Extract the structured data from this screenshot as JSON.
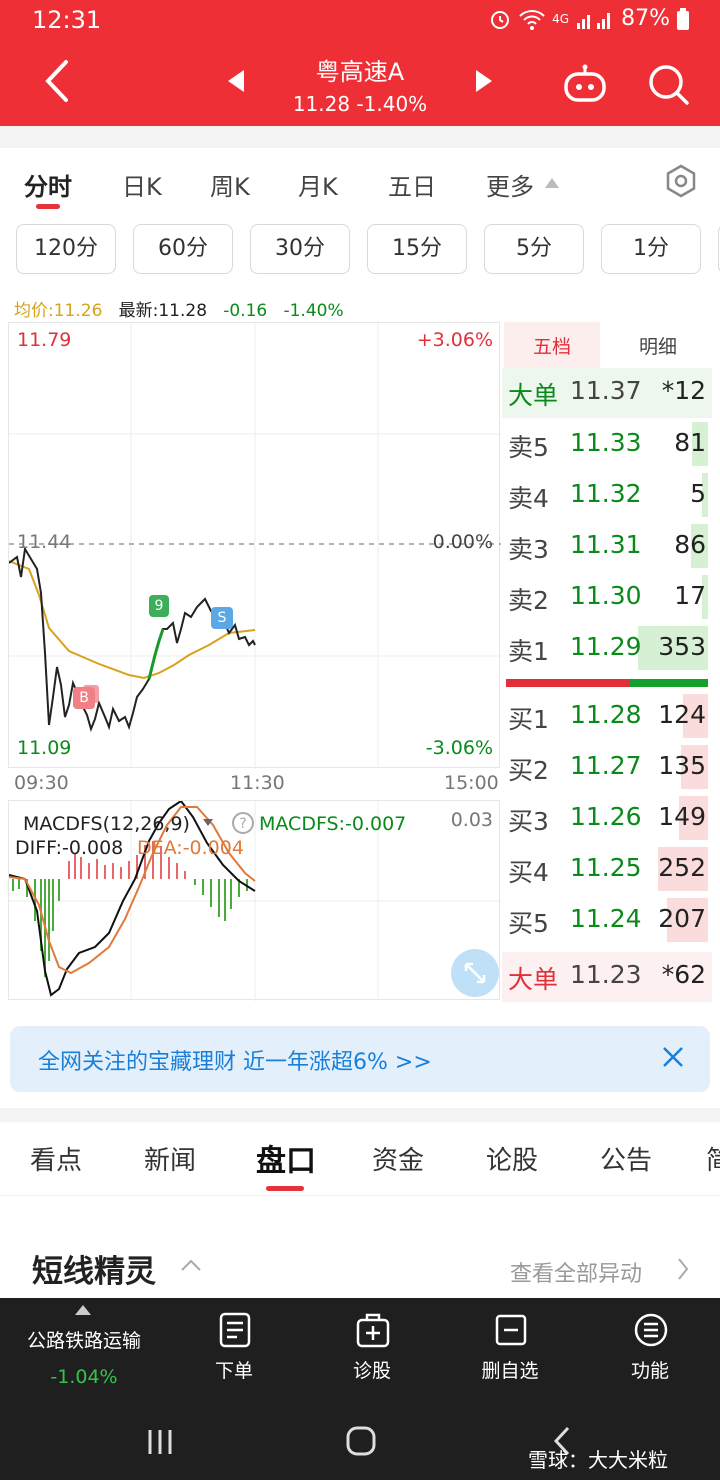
{
  "status_bar": {
    "time": "12:31",
    "network": "4G",
    "battery": "87%",
    "icons": [
      "alarm-icon",
      "wifi-icon",
      "signal-icon",
      "battery-icon"
    ]
  },
  "header": {
    "title": "粤高速A",
    "price_change": "11.28 -1.40%"
  },
  "chart_tabs": {
    "items": [
      "分时",
      "日K",
      "周K",
      "月K",
      "五日",
      "更多"
    ],
    "active": "分时"
  },
  "periods": [
    "120分",
    "60分",
    "30分",
    "15分",
    "5分",
    "1分"
  ],
  "info_line": {
    "avg": "均价:11.26",
    "latest": "最新:11.28",
    "change": "-0.16",
    "pct": "-1.40%"
  },
  "chart": {
    "price_top": "11.79",
    "price_mid": "11.44",
    "price_bottom": "11.09",
    "pct_top": "+3.06%",
    "pct_mid": "0.00%",
    "pct_bottom": "-3.06%",
    "time_start": "09:30",
    "time_mid": "11:30",
    "time_end": "15:00",
    "marker_b": "B",
    "marker_s": "S",
    "marker_9_green": "9",
    "marker_9_red": "9"
  },
  "macd": {
    "name": "MACDFS(12,26,9)",
    "value": "MACDFS:-0.007",
    "diff": "DIFF:-0.008",
    "dea": "DEA:-0.004",
    "scale_top": "0.03"
  },
  "order_book": {
    "tabs": [
      "五档",
      "明细"
    ],
    "big_sell": {
      "label": "大单",
      "price": "11.37",
      "vol": "*12"
    },
    "asks": [
      {
        "label": "卖5",
        "price": "11.33",
        "vol": "81",
        "fill": 0.23
      },
      {
        "label": "卖4",
        "price": "11.32",
        "vol": "5",
        "fill": 0.05
      },
      {
        "label": "卖3",
        "price": "11.31",
        "vol": "86",
        "fill": 0.24
      },
      {
        "label": "卖2",
        "price": "11.30",
        "vol": "17",
        "fill": 0.07
      },
      {
        "label": "卖1",
        "price": "11.29",
        "vol": "353",
        "fill": 1.0
      }
    ],
    "bids": [
      {
        "label": "买1",
        "price": "11.28",
        "vol": "124",
        "fill": 0.35
      },
      {
        "label": "买2",
        "price": "11.27",
        "vol": "135",
        "fill": 0.38
      },
      {
        "label": "买3",
        "price": "11.26",
        "vol": "149",
        "fill": 0.42
      },
      {
        "label": "买4",
        "price": "11.25",
        "vol": "252",
        "fill": 0.71
      },
      {
        "label": "买5",
        "price": "11.24",
        "vol": "207",
        "fill": 0.59
      }
    ],
    "big_buy": {
      "label": "大单",
      "price": "11.23",
      "vol": "*62"
    }
  },
  "banner": {
    "text": "全网关注的宝藏理财 近一年涨超6% >>"
  },
  "detail_tabs": {
    "items": [
      "看点",
      "新闻",
      "盘口",
      "资金",
      "论股",
      "公告",
      "简"
    ],
    "active": "盘口"
  },
  "section": {
    "title": "短线精灵",
    "view_all": "查看全部异动"
  },
  "bottom_bar": {
    "sector_name": "公路铁路运输",
    "sector_pct": "-1.04%",
    "items": [
      "下单",
      "诊股",
      "删自选",
      "功能"
    ]
  },
  "watermark": "雪球：大大米粒",
  "colors": {
    "brand_red": "#ee2f36",
    "up_red": "#e2303a",
    "down_green": "#0a8a1a",
    "avg_line": "#d8a21a",
    "link_blue": "#1a7fd8"
  }
}
